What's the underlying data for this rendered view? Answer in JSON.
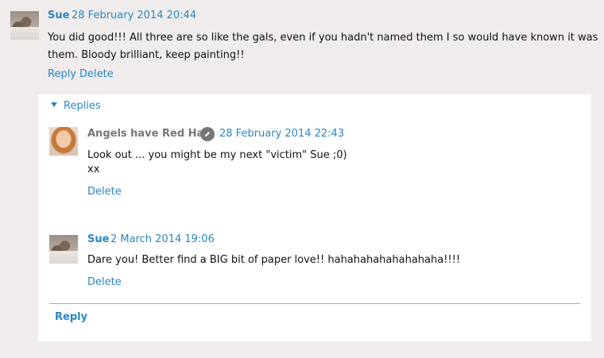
{
  "comment": {
    "author": "Sue",
    "date": "28 February 2014 20:44",
    "text_line1": "You did good!!! All three are so like the gals, even if you hadn't named them I so would have known it was",
    "text_line2": "them. Bloody brilliant, keep painting!!",
    "actions": {
      "reply": "Reply",
      "delete": "Delete"
    }
  },
  "replies": {
    "toggle_label": "Replies",
    "items": [
      {
        "author": "Angels have Red Hair",
        "date": "28 February 2014 22:43",
        "text_line1": "Look out ... you might be my next \"victim\" Sue ;0)",
        "text_line2": "xx",
        "delete": "Delete"
      },
      {
        "author": "Sue",
        "date": "2 March 2014 19:06",
        "text_line1": "Dare you! Better find a BIG bit of paper love!! hahahahahahahahaha!!!!",
        "delete": "Delete"
      }
    ],
    "reply_label": "Reply"
  },
  "colors": {
    "link": "#2a86c2",
    "background": "#f0eceb",
    "panel": "#ffffff"
  }
}
